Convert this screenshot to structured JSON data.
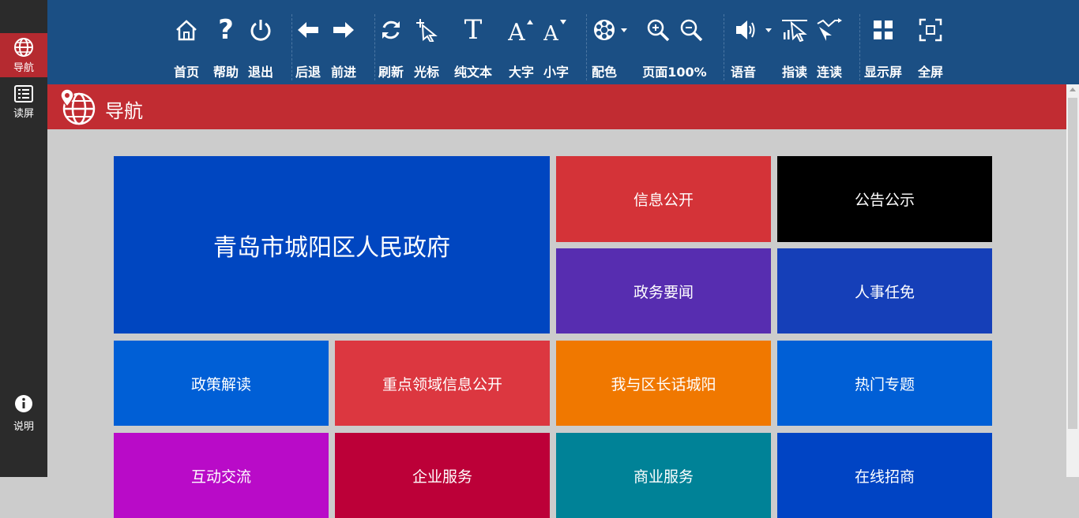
{
  "sidebar": {
    "nav_label": "导航",
    "read_label": "读屏",
    "help_label": "说明"
  },
  "toolbar": {
    "home": "首页",
    "help": "帮助",
    "exit": "退出",
    "back": "后退",
    "forward": "前进",
    "refresh": "刷新",
    "cursor": "光标",
    "plain_text": "纯文本",
    "zoom_in_text": "大字",
    "zoom_out_text": "小字",
    "color": "配色",
    "page_zoom": "页面100%",
    "voice": "语音",
    "point_read": "指读",
    "continuous_read": "连读",
    "display_screen": "显示屏",
    "fullscreen": "全屏"
  },
  "header": {
    "title": "导航"
  },
  "tiles": [
    {
      "label": "青岛市城阳区人民政府",
      "color": "#0046c0"
    },
    {
      "label": "信息公开",
      "color": "#d43338"
    },
    {
      "label": "公告公示",
      "color": "#000000"
    },
    {
      "label": "政务要闻",
      "color": "#572db0"
    },
    {
      "label": "人事任免",
      "color": "#153fb8"
    },
    {
      "label": "政策解读",
      "color": "#005fd6"
    },
    {
      "label": "重点领域信息公开",
      "color": "#dc3740"
    },
    {
      "label": "我与区长话城阳",
      "color": "#f07800"
    },
    {
      "label": "热门专题",
      "color": "#005fd6"
    },
    {
      "label": "互动交流",
      "color": "#b90bc8"
    },
    {
      "label": "企业服务",
      "color": "#bc0038"
    },
    {
      "label": "商业服务",
      "color": "#008297"
    },
    {
      "label": "在线招商",
      "color": "#0044c4"
    }
  ],
  "colors": {
    "toolbar_bg": "#1b4f84",
    "sidebar_bg": "#2b2b2b",
    "active_red": "#b52a30",
    "title_red": "#c12c32",
    "page_bg": "#cccccc"
  }
}
